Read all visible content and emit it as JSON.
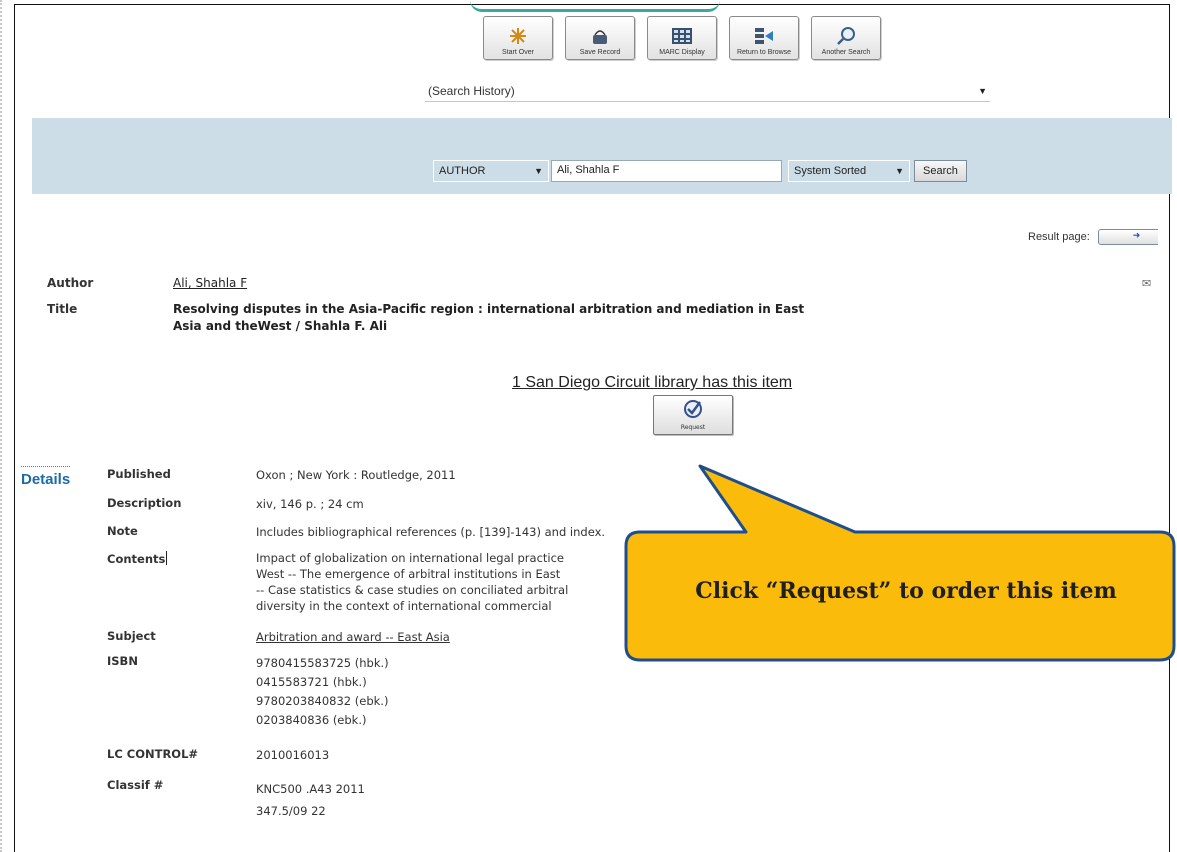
{
  "toolbar": {
    "buttons": [
      {
        "label": "Start Over",
        "icon": "star-icon"
      },
      {
        "label": "Save Record",
        "icon": "basket-icon"
      },
      {
        "label": "MARC Display",
        "icon": "grid-icon"
      },
      {
        "label": "Return to Browse",
        "icon": "browse-icon"
      },
      {
        "label": "Another Search",
        "icon": "magnifier-icon"
      }
    ]
  },
  "search": {
    "history": "(Search History)",
    "field": "AUTHOR",
    "term": "Ali, Shahla F",
    "sort": "System Sorted",
    "button": "Search"
  },
  "result_page": {
    "label": "Result page:"
  },
  "record": {
    "author_label": "Author",
    "author": "Ali, Shahla F",
    "title_label": "Title",
    "title_line1": "Resolving disputes in the Asia-Pacific region : international arbitration and mediation in East",
    "title_line2": "Asia and theWest / Shahla F. Ali",
    "availability": "1 San Diego Circuit library has this item",
    "request_label": "Request"
  },
  "details": {
    "tab": "Details",
    "rows": {
      "published_label": "Published",
      "published": "Oxon ; New York : Routledge, 2011",
      "description_label": "Description",
      "description": "xiv, 146 p. ; 24 cm",
      "note_label": "Note",
      "note": "Includes bibliographical references (p. [139]-143) and index.",
      "contents_label": "Contents",
      "contents_1": "Impact of globalization on international legal practice",
      "contents_2": "West -- The emergence of arbitral institutions in East",
      "contents_3": "-- Case statistics & case studies on conciliated arbitral",
      "contents_4": "diversity in the context of international commercial",
      "subject_label": "Subject",
      "subject": "Arbitration and award -- East Asia",
      "isbn_label": "ISBN",
      "isbn_1": "9780415583725 (hbk.)",
      "isbn_2": "0415583721 (hbk.)",
      "isbn_3": "9780203840832 (ebk.)",
      "isbn_4": "0203840836 (ebk.)",
      "lccn_label": "LC CONTROL#",
      "lccn": "2010016013",
      "classif_label": "Classif #",
      "classif_1": "KNC500 .A43 2011",
      "classif_2": "347.5/09 22"
    }
  },
  "callout": {
    "text": "Click “Request” to order this item",
    "fill": "#fbbb0a",
    "stroke": "#1f4e8c"
  }
}
